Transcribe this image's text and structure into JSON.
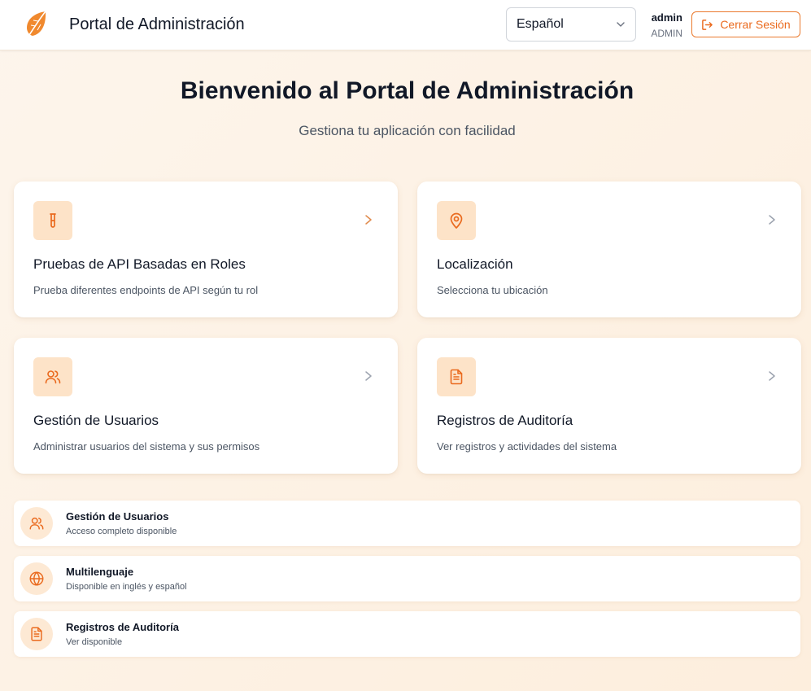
{
  "header": {
    "app_title": "Portal de Administración",
    "language_selected": "Español",
    "user_name": "admin",
    "user_role": "ADMIN",
    "logout_label": "Cerrar Sesión"
  },
  "hero": {
    "title": "Bienvenido al Portal de Administración",
    "subtitle": "Gestiona tu aplicación con facilidad"
  },
  "cards": [
    {
      "icon": "test-tube-icon",
      "title": "Pruebas de API Basadas en Roles",
      "description": "Prueba diferentes endpoints de API según tu rol"
    },
    {
      "icon": "map-pin-icon",
      "title": "Localización",
      "description": "Selecciona tu ubicación"
    },
    {
      "icon": "users-icon",
      "title": "Gestión de Usuarios",
      "description": "Administrar usuarios del sistema y sus permisos"
    },
    {
      "icon": "file-text-icon",
      "title": "Registros de Auditoría",
      "description": "Ver registros y actividades del sistema"
    }
  ],
  "features": [
    {
      "icon": "users-icon",
      "title": "Gestión de Usuarios",
      "description": "Acceso completo disponible"
    },
    {
      "icon": "globe-icon",
      "title": "Multilenguaje",
      "description": "Disponible en inglés y español"
    },
    {
      "icon": "file-text-icon",
      "title": "Registros de Auditoría",
      "description": "Ver disponible"
    }
  ],
  "colors": {
    "accent": "#ea6a1e",
    "icon_background": "#fde3c8",
    "background": "#fdf1e4"
  }
}
